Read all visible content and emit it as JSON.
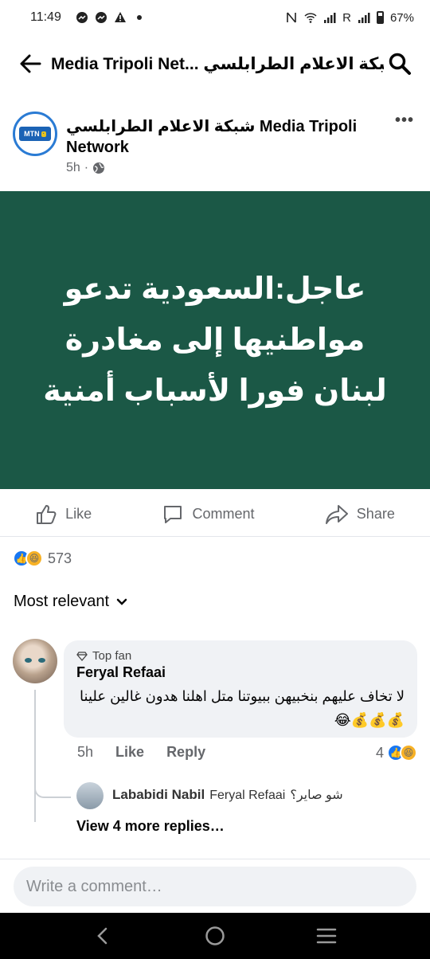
{
  "status_bar": {
    "time": "11:49",
    "carrier_letter": "R",
    "battery": "67%"
  },
  "header": {
    "title": "Media Tripoli Net... شبكة الاعلام الطرابلسي",
    "back_icon": "back-arrow-icon",
    "search_icon": "search-icon"
  },
  "post": {
    "page_name": "شبكة الاعلام الطرابلسي Media Tripoli Network",
    "avatar_text": "MTN",
    "time": "5h",
    "dot": "·",
    "more": "•••",
    "image_text": "عاجل:السعودية تدعو مواطنيها إلى مغادرة لبنان فورا لأسباب أمنية"
  },
  "actions": {
    "like": "Like",
    "comment": "Comment",
    "share": "Share"
  },
  "reactions": {
    "count": "573"
  },
  "sort": {
    "label": "Most relevant"
  },
  "comment": {
    "badge": "Top fan",
    "author": "Feryal Refaai",
    "text": "لا تخاف عليهم بنخبيهن ببيوتنا متل اهلنا هدون غالين علينا 💰💰💰😂",
    "time": "5h",
    "like": "Like",
    "reply": "Reply",
    "reaction_count": "4"
  },
  "reply": {
    "author": "Lababidi Nabil",
    "mention": "Feryal Refaai",
    "text": "شو صاير؟"
  },
  "more_replies": "View 4 more replies…",
  "input": {
    "placeholder": "Write a comment…"
  }
}
